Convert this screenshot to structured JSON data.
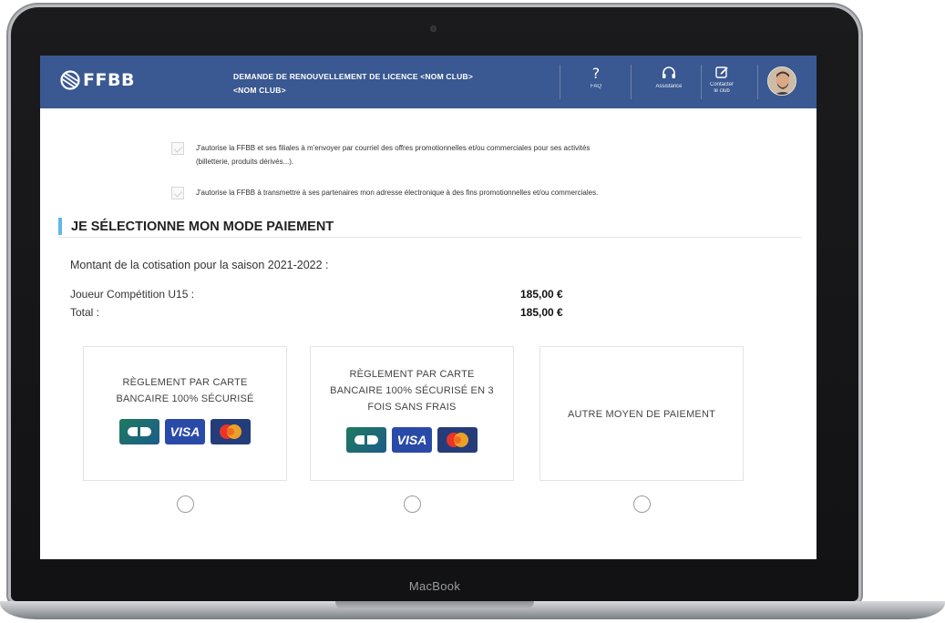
{
  "device": {
    "brand_label": "MacBook"
  },
  "header": {
    "logo_text": "FFBB",
    "title_line1": "DEMANDE DE RENOUVELLEMENT DE LICENCE <NOM CLUB>",
    "title_line2": "<NOM CLUB>",
    "nav": [
      {
        "icon": "question-icon",
        "label": "FAQ"
      },
      {
        "icon": "headset-icon",
        "label": "Assistance"
      },
      {
        "icon": "edit-icon",
        "label_line1": "Contacter",
        "label_line2": "le club"
      }
    ],
    "accent_color": "#3a5891"
  },
  "consents": [
    {
      "checked": false,
      "text_line1": "J'autorise la FFBB et ses filiales à m'envoyer par courriel des offres promotionnelles et/ou commerciales pour ses activités",
      "text_line2": "(billetterie, produits dérivés...)."
    },
    {
      "checked": false,
      "text_line1": "J'autorise la FFBB à transmettre à ses partenaires mon adresse électronique à des fins promotionnelles et/ou commerciales."
    }
  ],
  "payment_section": {
    "title": "JE SÉLECTIONNE MON MODE PAIEMENT",
    "title_accent_color": "#5fb8e6",
    "amount_label": "Montant de la cotisation pour la saison 2021-2022 :",
    "lines": [
      {
        "label": "Joueur Compétition U15 :",
        "value": "185,00 €"
      },
      {
        "label": "Total :",
        "value": "185,00 €"
      }
    ],
    "options": [
      {
        "line1": "RÈGLEMENT PAR CARTE",
        "line2": "BANCAIRE 100% SÉCURISÉ",
        "line3": "",
        "card_logos": [
          "CB",
          "VISA",
          "MasterCard"
        ],
        "selected": false
      },
      {
        "line1": "RÈGLEMENT PAR CARTE",
        "line2": "BANCAIRE 100% SÉCURISÉ EN 3",
        "line3": "FOIS SANS FRAIS",
        "card_logos": [
          "CB",
          "VISA",
          "MasterCard"
        ],
        "selected": false
      },
      {
        "line1": "AUTRE MOYEN DE PAIEMENT",
        "selected": false
      }
    ]
  }
}
